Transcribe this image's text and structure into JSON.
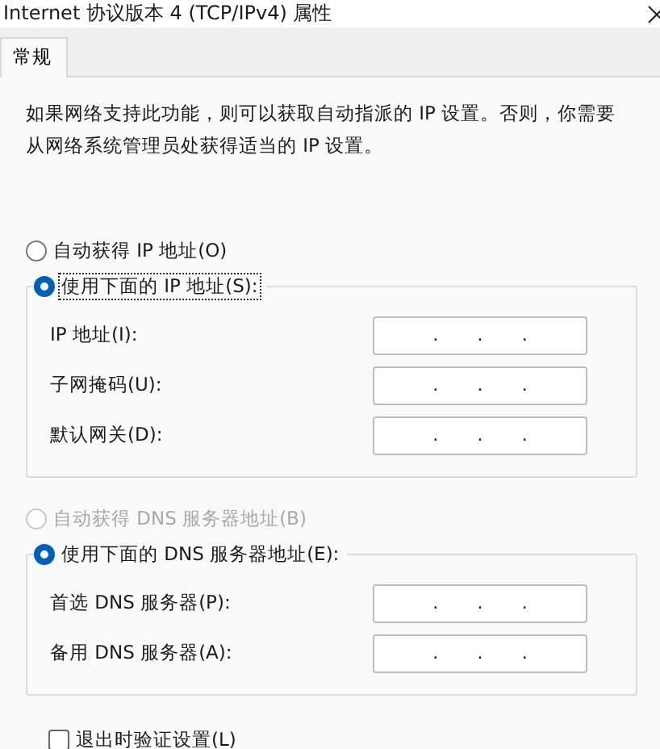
{
  "window": {
    "title": "Internet 协议版本 4 (TCP/IPv4) 属性"
  },
  "tabs": [
    {
      "label": "常规",
      "selected": true
    }
  ],
  "intro": "如果网络支持此功能，则可以获取自动指派的 IP 设置。否则，你需要从网络系统管理员处获得适当的 IP 设置。",
  "ip_mode": [
    {
      "label": "自动获得 IP 地址(O)",
      "selected": false,
      "disabled": false
    },
    {
      "label": "使用下面的 IP 地址(S):",
      "selected": true,
      "disabled": false
    }
  ],
  "ip_fields": [
    {
      "label": "IP 地址(I):",
      "separators": [
        ".",
        ".",
        "."
      ]
    },
    {
      "label": "子网掩码(U):",
      "separators": [
        ".",
        ".",
        "."
      ]
    },
    {
      "label": "默认网关(D):",
      "separators": [
        ".",
        ".",
        "."
      ]
    }
  ],
  "dns_mode": [
    {
      "label": "自动获得 DNS 服务器地址(B)",
      "selected": false,
      "disabled": true
    },
    {
      "label": "使用下面的 DNS 服务器地址(E):",
      "selected": true,
      "disabled": false
    }
  ],
  "dns_fields": [
    {
      "label": "首选 DNS 服务器(P):",
      "separators": [
        ".",
        ".",
        "."
      ]
    },
    {
      "label": "备用 DNS 服务器(A):",
      "separators": [
        ".",
        ".",
        "."
      ]
    }
  ],
  "validate": {
    "label": "退出时验证设置(L)",
    "checked": false
  }
}
